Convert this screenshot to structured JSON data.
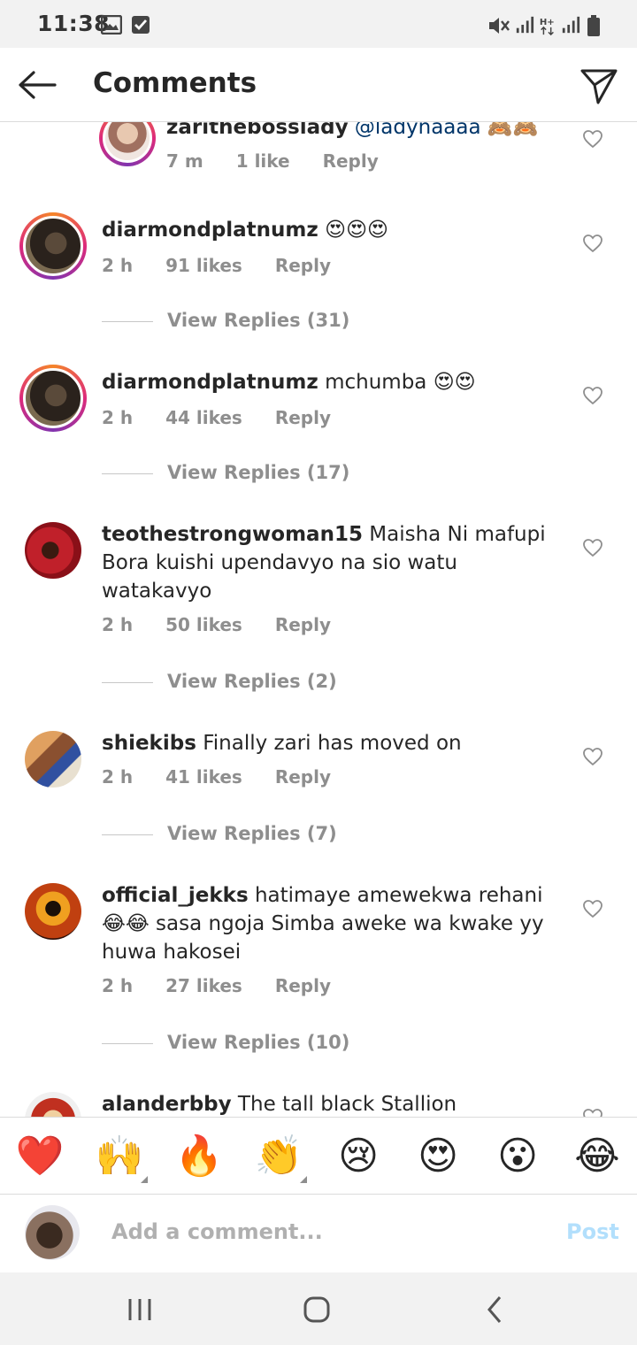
{
  "status_bar": {
    "time": "11:38",
    "icons": [
      "image-icon",
      "checkbox-icon",
      "mute-vibrate-icon",
      "signal-icon",
      "hplus-data-icon",
      "signal-icon-2",
      "battery-icon"
    ]
  },
  "header": {
    "title": "Comments",
    "back_icon": "arrow-left-icon",
    "share_icon": "paper-plane-icon"
  },
  "comments": [
    {
      "username": "zarithebosslady",
      "mention": "@ladynaaaa",
      "text": " 🙈🙈",
      "time": "7 m",
      "likes": "1 like",
      "reply": "Reply",
      "avatar_style": "story",
      "view_replies": ""
    },
    {
      "username": "diarmondplatnumz",
      "text": " 😍😍😍",
      "time": "2 h",
      "likes": "91 likes",
      "reply": "Reply",
      "avatar_style": "story",
      "view_replies": "View Replies (31)"
    },
    {
      "username": "diarmondplatnumz",
      "text": " mchumba 😍😍",
      "time": "2 h",
      "likes": "44 likes",
      "reply": "Reply",
      "avatar_style": "story",
      "view_replies": "View Replies (17)"
    },
    {
      "username": "teothestrongwoman15",
      "text": " Maisha Ni mafupi Bora kuishi upendavyo na sio watu watakavyo",
      "time": "2 h",
      "likes": "50 likes",
      "reply": "Reply",
      "avatar_style": "plain",
      "view_replies": "View Replies (2)"
    },
    {
      "username": "shiekibs",
      "text": " Finally zari has moved on",
      "time": "2 h",
      "likes": "41 likes",
      "reply": "Reply",
      "avatar_style": "plain",
      "view_replies": "View Replies (7)"
    },
    {
      "username": "official_jekks",
      "text": " hatimaye amewekwa rehani 😂😂 sasa ngoja Simba aweke wa kwake yy huwa hakosei",
      "time": "2 h",
      "likes": "27 likes",
      "reply": "Reply",
      "avatar_style": "plain",
      "view_replies": "View Replies (10)"
    },
    {
      "username": "alanderbby",
      "text": " The tall black Stallion handsome",
      "time": "",
      "likes": "",
      "reply": "",
      "avatar_style": "plain",
      "view_replies": ""
    }
  ],
  "emoji_bar": [
    "❤️",
    "🙌",
    "🔥",
    "👏",
    "😢",
    "😍",
    "😮",
    "😂"
  ],
  "composer": {
    "placeholder": "Add a comment...",
    "post_label": "Post"
  },
  "nav_bar": {
    "icons": [
      "recent-apps-icon",
      "home-icon",
      "back-icon"
    ]
  },
  "colors": {
    "accent": "#0095f6",
    "post_disabled": "#b2dffc",
    "secondary_text": "#8e8e8e",
    "mention": "#003569"
  }
}
